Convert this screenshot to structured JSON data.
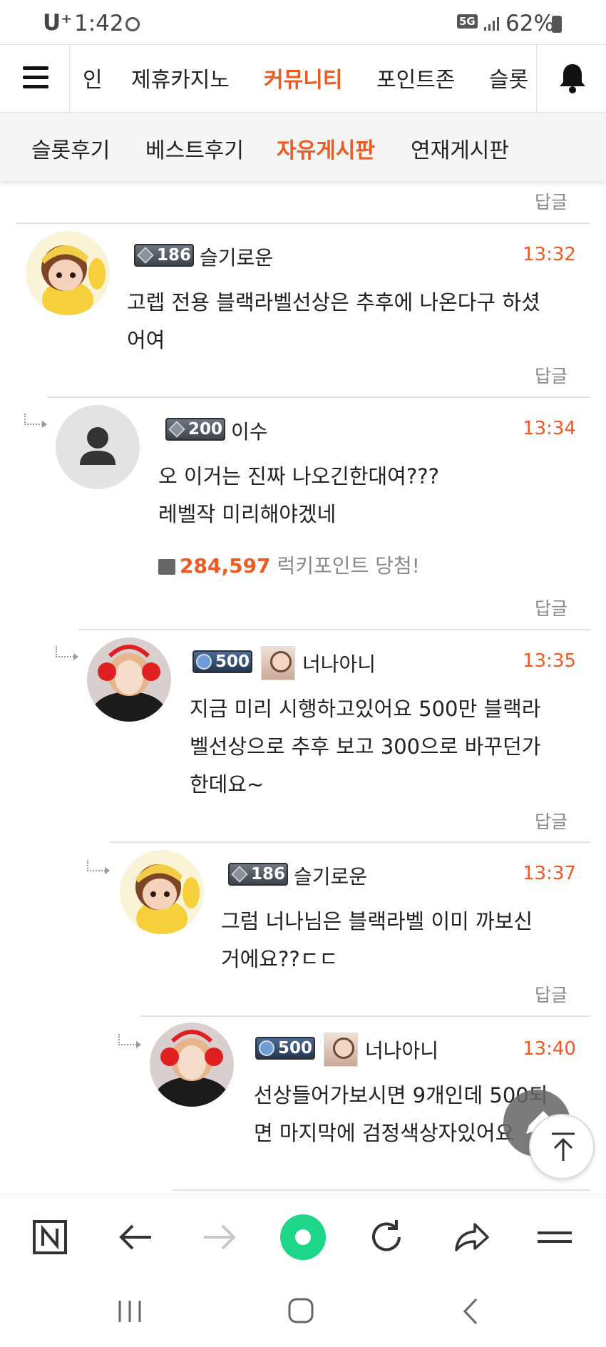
{
  "status_bar": {
    "carrier": "U⁺",
    "time": "1:42",
    "network": "5G",
    "battery": "62%"
  },
  "top_nav": {
    "tabs": [
      {
        "label": "인"
      },
      {
        "label": "제휴카지노"
      },
      {
        "label": "커뮤니티",
        "active": true
      },
      {
        "label": "포인트존"
      },
      {
        "label": "슬롯"
      }
    ]
  },
  "sub_nav": {
    "tabs": [
      {
        "label": "슬롯후기"
      },
      {
        "label": "베스트후기"
      },
      {
        "label": "자유게시판",
        "active": true
      },
      {
        "label": "연재게시판"
      }
    ]
  },
  "reply_label": "답글",
  "comments": [
    {
      "level": "186",
      "nickname": "슬기로운",
      "time": "13:32",
      "lines": [
        "고렙 전용 블랙라벨선상은 추후에 나온다구 하셨",
        "어여"
      ]
    },
    {
      "level": "200",
      "nickname": "이수",
      "time": "13:34",
      "lines": [
        "오 이거는 진짜 나오긴한대여???",
        "레벨작 미리해야겠네"
      ],
      "lucky": {
        "amount": "284,597",
        "text": "럭키포인트 당첨!"
      }
    },
    {
      "level": "500",
      "nickname": "너나아니",
      "time": "13:35",
      "lines": [
        "지금 미리 시행하고있어요 500만 블랙라",
        "벨선상으로 추후 보고 300으로 바꾸던가",
        "한데요~"
      ]
    },
    {
      "level": "186",
      "nickname": "슬기로운",
      "time": "13:37",
      "lines": [
        "그럼 너나님은 블랙라벨 이미 까보신",
        "거에요??ㄷㄷ"
      ]
    },
    {
      "level": "500",
      "nickname": "너나아니",
      "time": "13:40",
      "lines": [
        "선상들어가보시면 9개인데 500되",
        "면 마지막에 검정색상자있어요"
      ]
    }
  ],
  "colors": {
    "accent": "#f05a22",
    "text": "#222222",
    "muted": "#888888",
    "subnav_bg": "#f5f5f5"
  }
}
